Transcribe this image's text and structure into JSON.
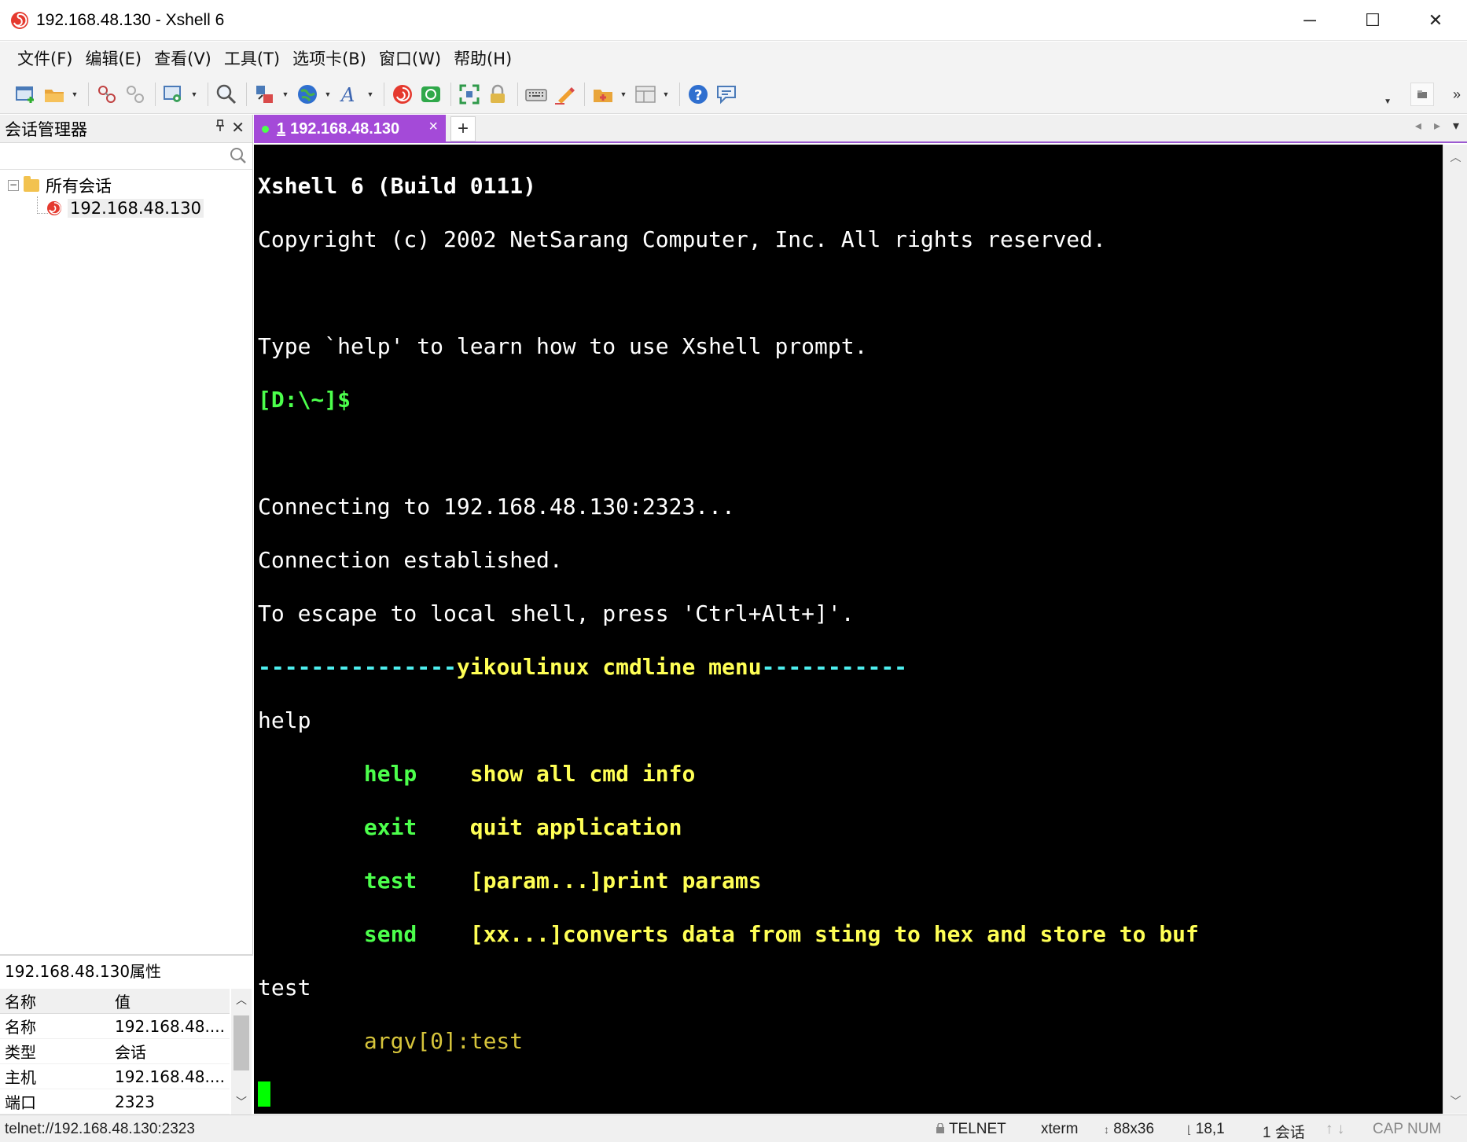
{
  "window": {
    "title": "192.168.48.130 - Xshell 6",
    "minimize": "─",
    "maximize": "☐",
    "close": "✕"
  },
  "menu": [
    "文件(F)",
    "编辑(E)",
    "查看(V)",
    "工具(T)",
    "选项卡(B)",
    "窗口(W)",
    "帮助(H)"
  ],
  "session_manager": {
    "title": "会话管理器",
    "search_placeholder": "",
    "root_label": "所有会话",
    "session_label": "192.168.48.130"
  },
  "properties": {
    "title": "192.168.48.130属性",
    "header_name": "名称",
    "header_value": "值",
    "rows": [
      {
        "k": "名称",
        "v": "192.168.48...."
      },
      {
        "k": "类型",
        "v": "会话"
      },
      {
        "k": "主机",
        "v": "192.168.48...."
      },
      {
        "k": "端口",
        "v": "2323"
      }
    ]
  },
  "tab": {
    "number": "1",
    "label": "192.168.48.130",
    "close": "×",
    "add": "+"
  },
  "terminal": {
    "l1": "Xshell 6 (Build 0111)",
    "l2": "Copyright (c) 2002 NetSarang Computer, Inc. All rights reserved.",
    "l4": "Type `help' to learn how to use Xshell prompt.",
    "prompt": "[D:\\~]$",
    "l7": "Connecting to 192.168.48.130:2323...",
    "l8": "Connection established.",
    "l9": "To escape to local shell, press 'Ctrl+Alt+]'.",
    "menu_prefix": "---------------",
    "menu_name": "yikoulinux cmdline menu",
    "menu_suffix": "-----------",
    "cmd_help": "help",
    "rows": [
      {
        "cmd": "help",
        "desc": "show all cmd info"
      },
      {
        "cmd": "exit",
        "desc": "quit application"
      },
      {
        "cmd": "test",
        "desc": "[param...]print params"
      },
      {
        "cmd": "send",
        "desc": "[xx...]converts data from sting to hex and store to buf"
      }
    ],
    "cmd_test": "test",
    "argv": "argv[0]:test"
  },
  "status": {
    "url": "telnet://192.168.48.130:2323",
    "protocol": "TELNET",
    "term": "xterm",
    "size": "88x36",
    "pos": "18,1",
    "sessions": "1 会话",
    "caps": "CAP NUM"
  },
  "colors": {
    "tab_accent": "#a44ad8",
    "terminal_bg": "#000000",
    "prompt_green": "#4cff4c",
    "menu_cyan": "#4ef0f0",
    "highlight_yellow": "#ffff55",
    "cursor": "#00ff00"
  }
}
